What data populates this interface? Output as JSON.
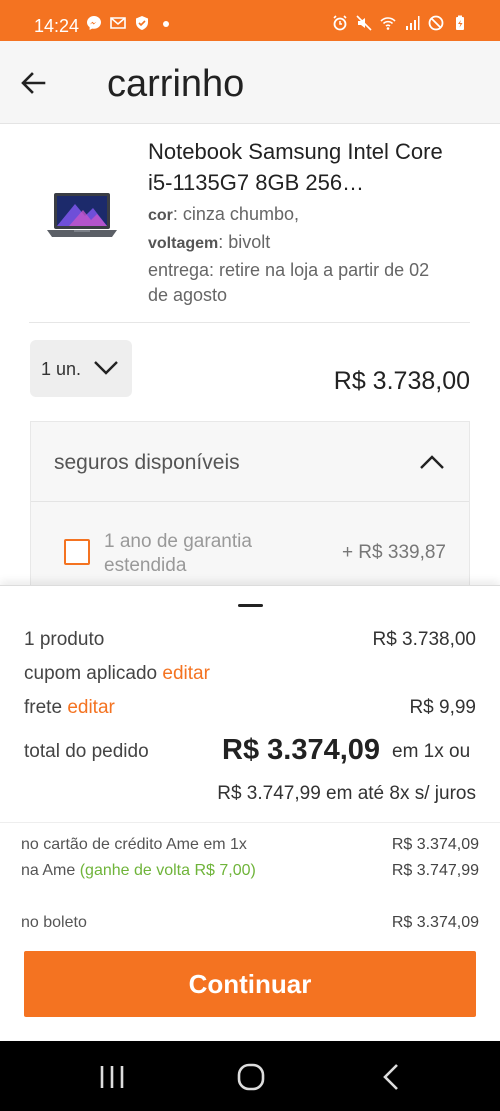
{
  "status_bar": {
    "time": "14:24",
    "left_icons": [
      "messenger-icon",
      "email-icon",
      "shield-icon",
      "dot-icon"
    ],
    "right_icons": [
      "alarm-icon",
      "mute-icon",
      "wifi-icon",
      "signal-icon",
      "no-disturb-icon",
      "battery-icon"
    ]
  },
  "app_bar": {
    "title": "carrinho",
    "back_icon": "arrow-left-icon"
  },
  "product": {
    "name": "Notebook Samsung Intel Core i5-1135G7 8GB 256…",
    "color_label": "cor",
    "color_value": ": cinza chumbo,",
    "voltage_label": "voltagem",
    "voltage_value": ": bivolt",
    "delivery": "entrega: retire na loja a partir de 02 de agosto",
    "quantity": "1 un.",
    "price": "R$ 3.738,00"
  },
  "insurance": {
    "title": "seguros disponíveis",
    "option_label": "1 ano de garantia estendida",
    "option_price": "+ R$ 339,87",
    "expanded": true
  },
  "summary": {
    "products_label": "1 produto",
    "products_value": "R$ 3.738,00",
    "coupon_label": "cupom aplicado",
    "coupon_edit": "editar",
    "shipping_label": "frete",
    "shipping_edit": "editar",
    "shipping_value": "R$ 9,99",
    "total_label": "total do pedido",
    "total_value": "R$ 3.374,09",
    "total_suffix": "em 1x ou",
    "installments": "R$ 3.747,99 em até 8x s/ juros",
    "payment": [
      {
        "label": "no cartão de crédito Ame em 1x",
        "value": "R$ 3.374,09"
      },
      {
        "label": "na Ame",
        "cashback": "(ganhe de volta R$ 7,00)",
        "value": "R$ 3.747,99"
      },
      {
        "label": "no boleto",
        "value": "R$ 3.374,09"
      }
    ]
  },
  "cta": {
    "label": "Continuar"
  },
  "colors": {
    "accent": "#f47321",
    "cashback": "#6fb43a"
  }
}
